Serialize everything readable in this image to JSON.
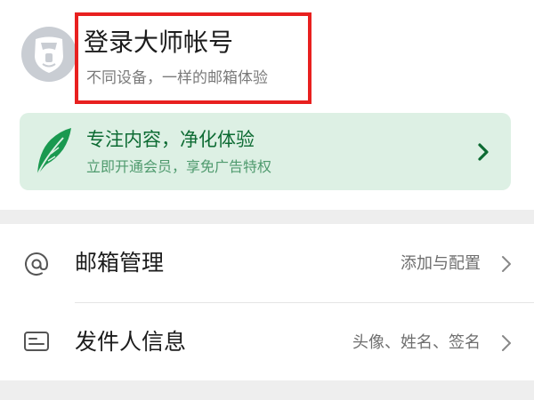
{
  "login": {
    "title": "登录大师帐号",
    "subtitle": "不同设备，一样的邮箱体验"
  },
  "promo": {
    "title": "专注内容，净化体验",
    "subtitle": "立即开通会员，享免广告特权"
  },
  "settings": {
    "mailbox_management": {
      "label": "邮箱管理",
      "value": "添加与配置"
    },
    "sender_info": {
      "label": "发件人信息",
      "value": "头像、姓名、签名"
    }
  },
  "icons": {
    "avatar": "lion-avatar-icon",
    "promo": "feather-icon",
    "mailbox": "at-sign-icon",
    "sender": "id-card-icon",
    "chevron": "chevron-right-icon"
  },
  "colors": {
    "highlight": "#e8201f",
    "promo_background": "#ddf0e4",
    "promo_title": "#0d6b33",
    "promo_accent": "#1a9950"
  }
}
